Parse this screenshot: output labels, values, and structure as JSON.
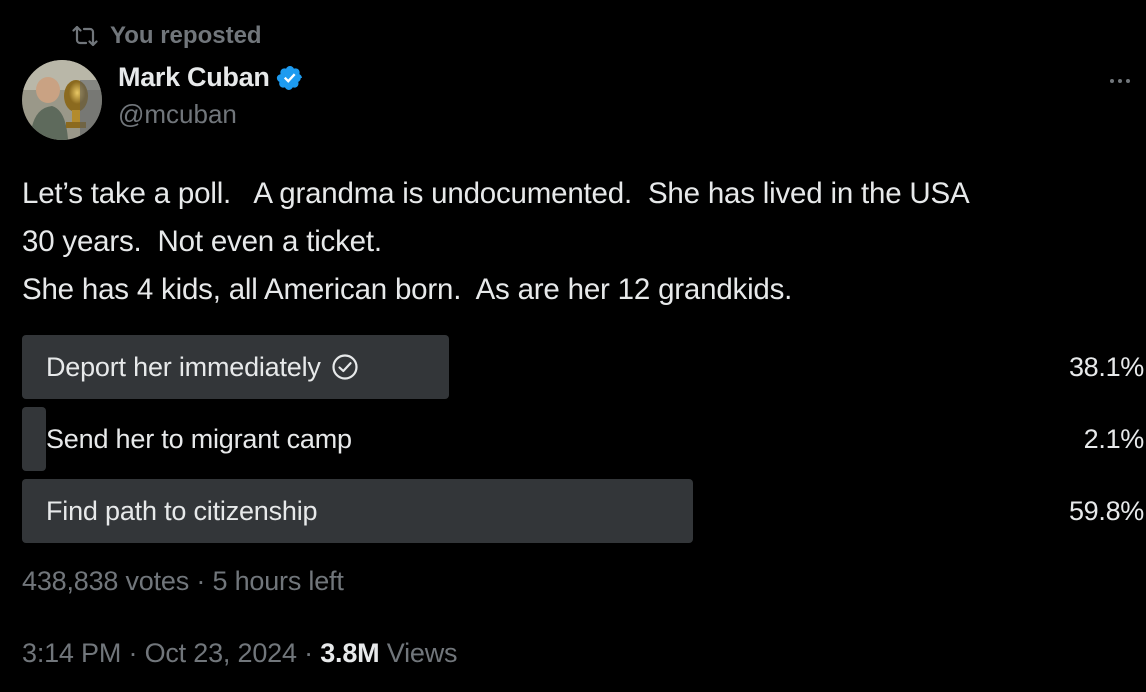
{
  "repost": {
    "label": "You reposted"
  },
  "author": {
    "name": "Mark Cuban",
    "handle": "@mcuban",
    "verified_color": "#1d9bf0"
  },
  "tweet": {
    "lines": [
      "Let’s take a poll.   A grandma is undocumented.  She has lived in the USA",
      "30 years.  Not even a ticket.",
      "She has 4 kids, all American born.  As are her 12 grandkids."
    ]
  },
  "poll": {
    "options": [
      {
        "label": "Deport her immediately",
        "percent_text": "38.1%",
        "percent": 38.1,
        "selected": true
      },
      {
        "label": "Send her to migrant camp",
        "percent_text": "2.1%",
        "percent": 2.1,
        "selected": false
      },
      {
        "label": "Find path to citizenship",
        "percent_text": "59.8%",
        "percent": 59.8,
        "selected": false
      }
    ],
    "votes": "438,838 votes",
    "separator": "·",
    "time_left": "5 hours left"
  },
  "meta": {
    "time": "3:14 PM",
    "separator": "·",
    "date": "Oct 23, 2024",
    "views_count": "3.8M",
    "views_label": "Views"
  },
  "icons": {
    "repost": "repost-icon",
    "verified": "verified-badge-icon",
    "more": "more-options-icon",
    "check": "check-circle-icon"
  },
  "colors": {
    "background": "#000000",
    "text": "#e7e9ea",
    "secondary": "#71767b",
    "bar": "#333639",
    "accent": "#1d9bf0"
  }
}
